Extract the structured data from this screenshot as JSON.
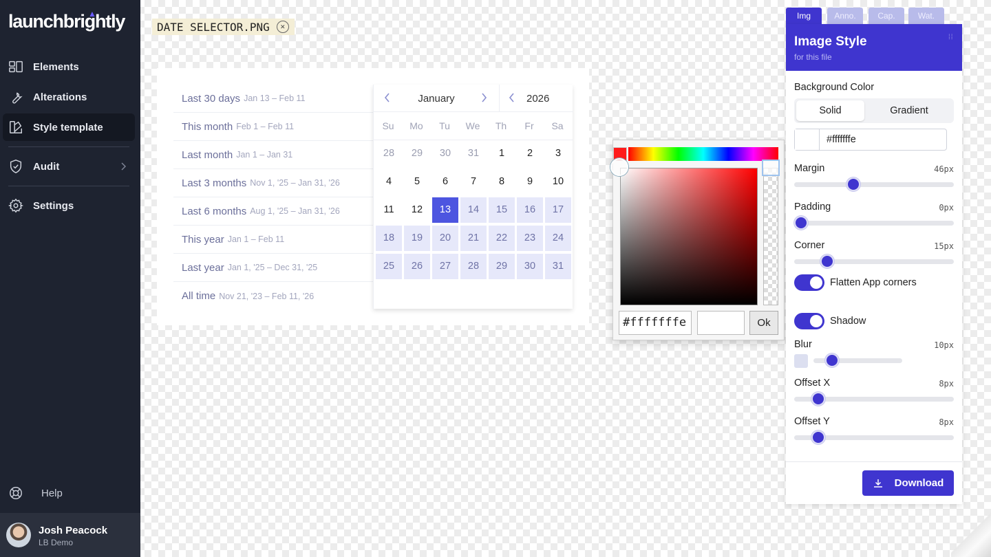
{
  "sidebar": {
    "logo": "launchbrightly",
    "items": [
      {
        "label": "Elements",
        "icon": "layout-icon"
      },
      {
        "label": "Alterations",
        "icon": "wrench-icon"
      },
      {
        "label": "Style template",
        "icon": "palette-icon",
        "active": true
      },
      {
        "label": "Audit",
        "icon": "shield-check-icon"
      },
      {
        "label": "Settings",
        "icon": "gear-icon"
      }
    ],
    "help": "Help",
    "user": {
      "name": "Josh Peacock",
      "org": "LB Demo"
    }
  },
  "file": {
    "name": "DATE SELECTOR.PNG"
  },
  "datepicker": {
    "presets": [
      {
        "label": "Last 30 days",
        "range": "Jan 13 – Feb 11"
      },
      {
        "label": "This month",
        "range": "Feb 1 – Feb 11"
      },
      {
        "label": "Last month",
        "range": "Jan 1 – Jan 31"
      },
      {
        "label": "Last 3 months",
        "range": "Nov 1, '25 – Jan 31, '26"
      },
      {
        "label": "Last 6 months",
        "range": "Aug 1, '25 – Jan 31, '26"
      },
      {
        "label": "This year",
        "range": "Jan 1 – Feb 11"
      },
      {
        "label": "Last year",
        "range": "Jan 1, '25 – Dec 31, '25"
      },
      {
        "label": "All time",
        "range": "Nov 21, '23 – Feb 11, '26"
      }
    ],
    "month": "January",
    "year": "2026",
    "weekdays": [
      "Su",
      "Mo",
      "Tu",
      "We",
      "Th",
      "Fr",
      "Sa"
    ],
    "weeks": [
      [
        "28",
        "29",
        "30",
        "31",
        "1",
        "2",
        "3"
      ],
      [
        "4",
        "5",
        "6",
        "7",
        "8",
        "9",
        "10"
      ],
      [
        "11",
        "12",
        "13",
        "14",
        "15",
        "16",
        "17"
      ],
      [
        "18",
        "19",
        "20",
        "21",
        "22",
        "23",
        "24"
      ],
      [
        "25",
        "26",
        "27",
        "28",
        "29",
        "30",
        "31"
      ]
    ],
    "selected": "13",
    "range_end": "31"
  },
  "colorpicker": {
    "hex_value": "#fffffffe",
    "ok_label": "Ok",
    "swatch_color": "#ff1a1a"
  },
  "panel": {
    "tabs": [
      "Img",
      "Anno.",
      "Cap.",
      "Wat."
    ],
    "active_tab": "Img",
    "title": "Image Style",
    "subtitle": "for this file",
    "bg_label": "Background Color",
    "bg_modes": [
      "Solid",
      "Gradient"
    ],
    "bg_mode_selected": "Solid",
    "bg_value": "#fffffffe",
    "margin": {
      "label": "Margin",
      "value": "46px",
      "fraction": 0.36
    },
    "padding": {
      "label": "Padding",
      "value": "0px",
      "fraction": 0.0
    },
    "corner": {
      "label": "Corner",
      "value": "15px",
      "fraction": 0.18
    },
    "flatten": {
      "label": "Flatten App corners",
      "on": true
    },
    "shadow": {
      "label": "Shadow",
      "on": true
    },
    "blur": {
      "label": "Blur",
      "value": "10px",
      "fraction": 0.16
    },
    "offset_x": {
      "label": "Offset X",
      "value": "8px",
      "fraction": 0.12
    },
    "offset_y": {
      "label": "Offset Y",
      "value": "8px",
      "fraction": 0.12
    },
    "download_label": "Download"
  },
  "colors": {
    "accent": "#3f35cf",
    "sidebar_bg": "#1e2330",
    "range": "#e6e8fa",
    "selected_day": "#4d55e0"
  }
}
